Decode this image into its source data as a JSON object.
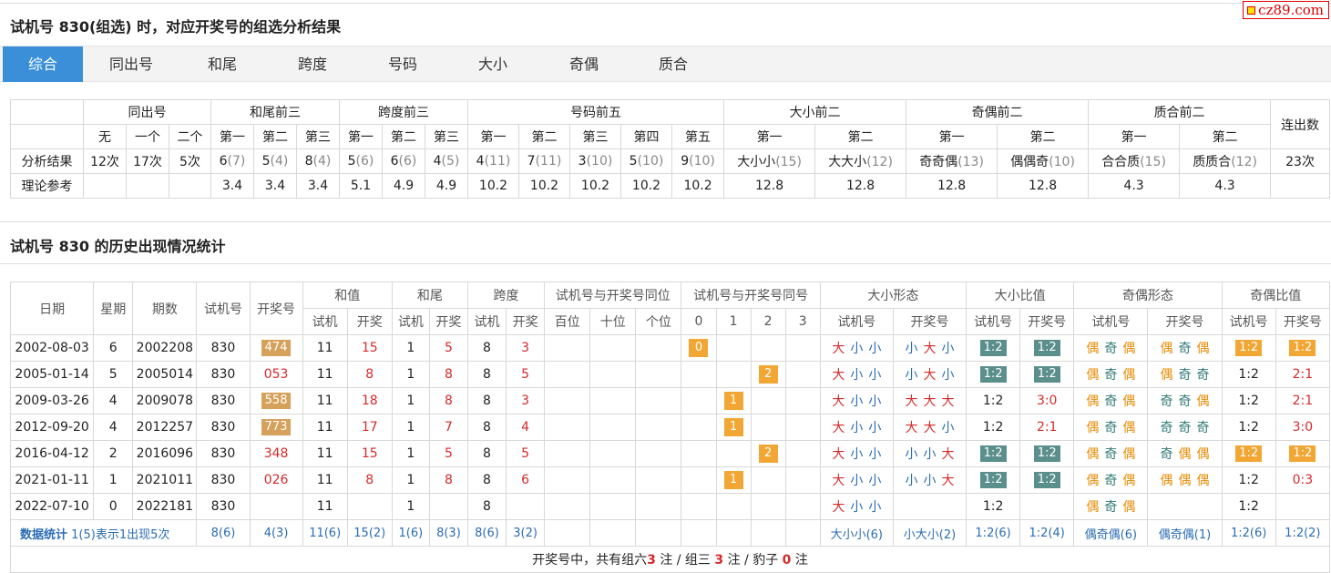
{
  "header": {
    "title": "试机号 830(组选) 时，对应开奖号的组选分析结果",
    "brand": "cz89.com"
  },
  "tabs": [
    "综合",
    "同出号",
    "和尾",
    "跨度",
    "号码",
    "大小",
    "奇偶",
    "质合"
  ],
  "analysis": {
    "groups": [
      "同出号",
      "和尾前三",
      "跨度前三",
      "号码前五",
      "大小前二",
      "奇偶前二",
      "质合前二",
      "连出数"
    ],
    "sub": [
      "无",
      "一个",
      "二个",
      "第一",
      "第二",
      "第三",
      "第一",
      "第二",
      "第三",
      "第一",
      "第二",
      "第三",
      "第四",
      "第五",
      "第一",
      "第二",
      "第一",
      "第二",
      "第一",
      "第二"
    ],
    "row1_label": "分析结果",
    "row1": [
      [
        "12次",
        ""
      ],
      [
        "17次",
        ""
      ],
      [
        "5次",
        ""
      ],
      [
        "6",
        "(7)"
      ],
      [
        "5",
        "(4)"
      ],
      [
        "8",
        "(4)"
      ],
      [
        "5",
        "(6)"
      ],
      [
        "6",
        "(6)"
      ],
      [
        "4",
        "(5)"
      ],
      [
        "4",
        "(11)"
      ],
      [
        "7",
        "(11)"
      ],
      [
        "3",
        "(10)"
      ],
      [
        "5",
        "(10)"
      ],
      [
        "9",
        "(10)"
      ],
      [
        "大小小",
        "(15)"
      ],
      [
        "大大小",
        "(12)"
      ],
      [
        "奇奇偶",
        "(13)"
      ],
      [
        "偶偶奇",
        "(10)"
      ],
      [
        "合合质",
        "(15)"
      ],
      [
        "质质合",
        "(12)"
      ],
      [
        "23次",
        ""
      ]
    ],
    "row2_label": "理论参考",
    "row2": [
      "",
      "",
      "",
      "3.4",
      "3.4",
      "3.4",
      "5.1",
      "4.9",
      "4.9",
      "10.2",
      "10.2",
      "10.2",
      "10.2",
      "10.2",
      "12.8",
      "12.8",
      "12.8",
      "12.8",
      "4.3",
      "4.3",
      ""
    ]
  },
  "history": {
    "title": "试机号 830 的历史出现情况统计",
    "head1": [
      "日期",
      "星期",
      "期数",
      "试机号",
      "开奖号",
      "和值",
      "和尾",
      "跨度",
      "试机号与开奖号同位",
      "试机号与开奖号同号",
      "大小形态",
      "大小比值",
      "奇偶形态",
      "奇偶比值"
    ],
    "head2": [
      "试机",
      "开奖",
      "试机",
      "开奖",
      "试机",
      "开奖",
      "百位",
      "十位",
      "个位",
      "0",
      "1",
      "2",
      "3",
      "试机号",
      "开奖号",
      "试机号",
      "开奖号",
      "试机号",
      "开奖号",
      "试机号",
      "开奖号"
    ],
    "rows": [
      {
        "date": "2002-08-03",
        "week": "6",
        "issue": "2002208",
        "sj": "830",
        "kj": "474",
        "kjpill": true,
        "hs": "11",
        "hk": "15",
        "ws": "1",
        "wk": "5",
        "ks": "8",
        "kk": "3",
        "tong": [
          0,
          "0"
        ],
        "dxs": "大小小",
        "dxk": "小大小",
        "dbs": "1:2",
        "dbk": "1:2",
        "dbsp": true,
        "dbkp": true,
        "jos": "偶奇偶",
        "jok": "偶奇偶",
        "jbs": "1:2",
        "jbk": "1:2",
        "jbsp": true,
        "jbkp": true
      },
      {
        "date": "2005-01-14",
        "week": "5",
        "issue": "2005014",
        "sj": "830",
        "kj": "053",
        "kjpill": false,
        "hs": "11",
        "hk": "8",
        "ws": "1",
        "wk": "8",
        "ks": "8",
        "kk": "5",
        "tong": [
          2,
          "2"
        ],
        "dxs": "大小小",
        "dxk": "小大小",
        "dbs": "1:2",
        "dbk": "1:2",
        "dbsp": true,
        "dbkp": true,
        "jos": "偶奇偶",
        "jok": "偶奇奇",
        "jbs": "1:2",
        "jbk": "2:1",
        "jbsp": false,
        "jbkp": false
      },
      {
        "date": "2009-03-26",
        "week": "4",
        "issue": "2009078",
        "sj": "830",
        "kj": "558",
        "kjpill": true,
        "hs": "11",
        "hk": "18",
        "ws": "1",
        "wk": "8",
        "ks": "8",
        "kk": "3",
        "tong": [
          1,
          "1"
        ],
        "dxs": "大小小",
        "dxk": "大大大",
        "dbs": "1:2",
        "dbk": "3:0",
        "dbsp": false,
        "dbkp": false,
        "jos": "偶奇偶",
        "jok": "奇奇偶",
        "jbs": "1:2",
        "jbk": "2:1",
        "jbsp": false,
        "jbkp": false
      },
      {
        "date": "2012-09-20",
        "week": "4",
        "issue": "2012257",
        "sj": "830",
        "kj": "773",
        "kjpill": true,
        "hs": "11",
        "hk": "17",
        "ws": "1",
        "wk": "7",
        "ks": "8",
        "kk": "4",
        "tong": [
          1,
          "1"
        ],
        "dxs": "大小小",
        "dxk": "大大小",
        "dbs": "1:2",
        "dbk": "2:1",
        "dbsp": false,
        "dbkp": false,
        "jos": "偶奇偶",
        "jok": "奇奇奇",
        "jbs": "1:2",
        "jbk": "3:0",
        "jbsp": false,
        "jbkp": false
      },
      {
        "date": "2016-04-12",
        "week": "2",
        "issue": "2016096",
        "sj": "830",
        "kj": "348",
        "kjpill": false,
        "hs": "11",
        "hk": "15",
        "ws": "1",
        "wk": "5",
        "ks": "8",
        "kk": "5",
        "tong": [
          2,
          "2"
        ],
        "dxs": "大小小",
        "dxk": "小小大",
        "dbs": "1:2",
        "dbk": "1:2",
        "dbsp": true,
        "dbkp": true,
        "jos": "偶奇偶",
        "jok": "奇偶偶",
        "jbs": "1:2",
        "jbk": "1:2",
        "jbsp": true,
        "jbkp": true
      },
      {
        "date": "2021-01-11",
        "week": "1",
        "issue": "2021011",
        "sj": "830",
        "kj": "026",
        "kjpill": false,
        "hs": "11",
        "hk": "8",
        "ws": "1",
        "wk": "8",
        "ks": "8",
        "kk": "6",
        "tong": [
          1,
          "1"
        ],
        "dxs": "大小小",
        "dxk": "小小大",
        "dbs": "1:2",
        "dbk": "1:2",
        "dbsp": true,
        "dbkp": true,
        "jos": "偶奇偶",
        "jok": "偶偶偶",
        "jbs": "1:2",
        "jbk": "0:3",
        "jbsp": false,
        "jbkp": false
      },
      {
        "date": "2022-07-10",
        "week": "0",
        "issue": "2022181",
        "sj": "830",
        "kj": "",
        "kjpill": false,
        "hs": "11",
        "hk": "",
        "ws": "1",
        "wk": "",
        "ks": "8",
        "kk": "",
        "tong": [
          -1,
          ""
        ],
        "dxs": "大小小",
        "dxk": "",
        "dbs": "1:2",
        "dbk": "",
        "dbsp": false,
        "dbkp": false,
        "jos": "偶奇偶",
        "jok": "",
        "jbs": "1:2",
        "jbk": "",
        "jbsp": false,
        "jbkp": false
      }
    ],
    "summary": {
      "label": "数据统计",
      "note": "1(5)表示1出现5次",
      "sj": "8(6)",
      "kj": "4(3)",
      "hs": "11(6)",
      "hk": "15(2)",
      "ws": "1(6)",
      "wk": "8(3)",
      "ks": "8(6)",
      "kk": "3(2)",
      "dxs": "大小小(6)",
      "dxk": "小大小(2)",
      "dbs": "1:2(6)",
      "dbk": "1:2(4)",
      "jos": "偶奇偶(6)",
      "jok": "偶奇偶(1)",
      "jbs": "1:2(6)",
      "jbk": "1:2(2)"
    },
    "footer": {
      "a": "开奖号中，共有组六",
      "n1": "3",
      "b": "注 / 组三",
      "n2": "3",
      "c": "注 / 豹子",
      "n3": "0",
      "d": "注"
    }
  }
}
